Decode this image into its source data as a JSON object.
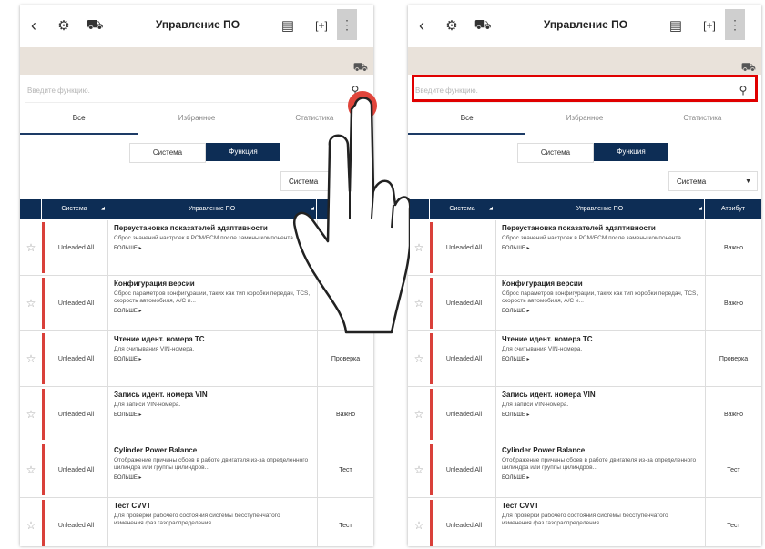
{
  "screen": {
    "title": "Управление ПО",
    "search_placeholder": "Введите функцию.",
    "tabs": [
      "Все",
      "Избранное",
      "Статистика"
    ],
    "segments": [
      "Система",
      "Функция"
    ],
    "dropdown_value": "Система",
    "columns": {
      "system": "Система",
      "mgmt": "Управление ПО",
      "attr": "Атрибут"
    },
    "rows": [
      {
        "system": "Unleaded All",
        "title": "Переустановка показателей адаптивности",
        "desc": "Сброс значений настроек в PCM/ECM после замены компонента",
        "more": "БОЛЬШЕ ▸",
        "attr": "Важно"
      },
      {
        "system": "Unleaded All",
        "title": "Конфигурация версии",
        "desc": "Сброс параметров конфигурации, таких как тип коробки передач, TCS, скорость автомобиля, A/C и...",
        "more": "БОЛЬШЕ ▸",
        "attr": "Важно"
      },
      {
        "system": "Unleaded All",
        "title": "Чтение идент. номера ТС",
        "desc": "Для считывания VIN-номера.",
        "more": "БОЛЬШЕ ▸",
        "attr": "Проверка"
      },
      {
        "system": "Unleaded All",
        "title": "Запись идент. номера VIN",
        "desc": "Для записи VIN-номера.",
        "more": "БОЛЬШЕ ▸",
        "attr": "Важно"
      },
      {
        "system": "Unleaded All",
        "title": "Cylinder Power Balance",
        "desc": "Отображение причины сбоев в работе двигателя из-за определенного цилиндра или группы цилиндров...",
        "more": "БОЛЬШЕ ▸",
        "attr": "Тест"
      },
      {
        "system": "Unleaded All",
        "title": "Тест CVVT",
        "desc": "Для проверки рабочего состояния системы бесступенчатого изменения фаз газораспределения...",
        "more": "",
        "attr": "Тест"
      }
    ]
  },
  "colors": {
    "accent": "#0d2d55",
    "highlight": "#e00000",
    "row_bar": "#d9403a"
  },
  "icons": [
    "back-icon",
    "gear-icon",
    "car-icon",
    "document-icon",
    "capture-icon",
    "more-icon",
    "search-icon",
    "star-icon",
    "hand-pointer-icon"
  ]
}
